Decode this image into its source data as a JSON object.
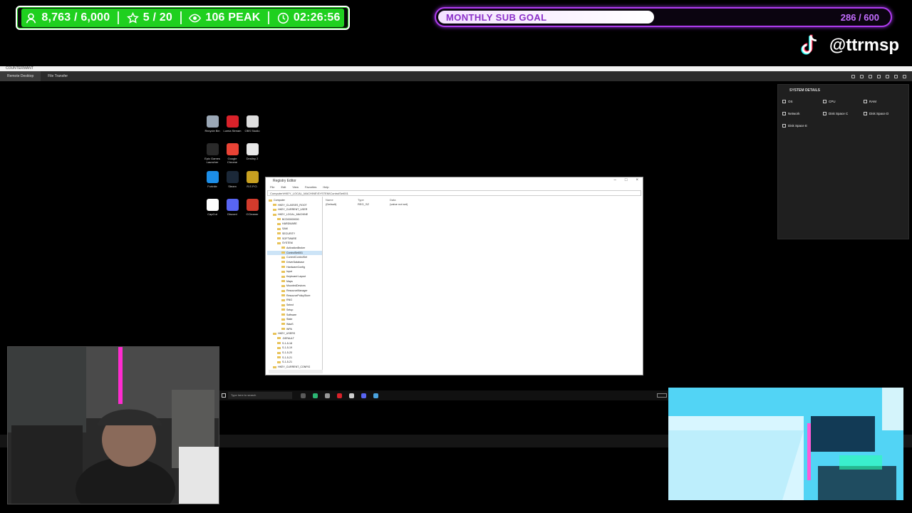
{
  "overlay": {
    "stats": {
      "followers": "8,763 / 6,000",
      "subs": "5 / 20",
      "peak": "106 PEAK",
      "timer": "02:26:56"
    },
    "goal": {
      "label": "MONTHLY SUB GOAL",
      "count": "286 / 600",
      "progress": 0.48
    },
    "tiktok_handle": "@ttrmsp"
  },
  "remote_desktop": {
    "title": "COUNTERMANT",
    "tabs": [
      "Remote Desktop",
      "File Transfer"
    ]
  },
  "desktop_icons": [
    {
      "label": "Recycle Bin",
      "icon": "recycle-bin-icon",
      "color": "#9aa7b5"
    },
    {
      "label": "Lumia Stream",
      "icon": "lumia-icon",
      "color": "#d9222a"
    },
    {
      "label": "OBS Studio",
      "icon": "obs-icon",
      "color": "#dddddd"
    },
    {
      "label": "Epic Games Launcher",
      "icon": "epic-icon",
      "color": "#2a2a2a"
    },
    {
      "label": "Google Chrome",
      "icon": "chrome-icon",
      "color": "#e94335"
    },
    {
      "label": "Destiny 2",
      "icon": "destiny-icon",
      "color": "#e8e8e8"
    },
    {
      "label": "Fortnite",
      "icon": "fortnite-icon",
      "color": "#1c8ee8"
    },
    {
      "label": "Steam",
      "icon": "steam-icon",
      "color": "#1b2838"
    },
    {
      "label": "R.E.P.O.",
      "icon": "repo-icon",
      "color": "#c8a020"
    },
    {
      "label": "CapCut",
      "icon": "capcut-icon",
      "color": "#ffffff"
    },
    {
      "label": "Discord",
      "icon": "discord-icon",
      "color": "#5865f2"
    },
    {
      "label": "CCleaner",
      "icon": "ccleaner-icon",
      "color": "#d23b2c"
    }
  ],
  "system_details": {
    "header": "SYSTEM DETAILS",
    "items": [
      {
        "label": "OS"
      },
      {
        "label": "CPU"
      },
      {
        "label": "RAM"
      },
      {
        "label": "Network"
      },
      {
        "label": "Disk Space C"
      },
      {
        "label": "Disk Space D"
      },
      {
        "label": "Disk Space E"
      }
    ]
  },
  "regedit": {
    "title": "Registry Editor",
    "menu": [
      "File",
      "Edit",
      "View",
      "Favorites",
      "Help"
    ],
    "address": "Computer\\HKEY_LOCAL_MACHINE\\SYSTEM\\ControlSet001",
    "tree": [
      "Computer",
      "HKEY_CLASSES_ROOT",
      "HKEY_CURRENT_USER",
      "HKEY_LOCAL_MACHINE",
      "BCD00000000",
      "HARDWARE",
      "SAM",
      "SECURITY",
      "SOFTWARE",
      "SYSTEM",
      "ActivationBroker",
      "ControlSet001",
      "CurrentControlSet",
      "DriverDatabase",
      "HardwareConfig",
      "Input",
      "Keyboard Layout",
      "Maps",
      "MountedDevices",
      "ResourceManager",
      "ResourcePolicyStore",
      "RNG",
      "Select",
      "Setup",
      "Software",
      "State",
      "WaaS",
      "WPA",
      "HKEY_USERS",
      ".DEFAULT",
      "S-1-5-18",
      "S-1-5-19",
      "S-1-5-20",
      "S-1-5-21",
      "S-1-5-21",
      "HKEY_CURRENT_CONFIG"
    ],
    "columns": [
      "Name",
      "Type",
      "Data"
    ],
    "rows": [
      {
        "name": "(Default)",
        "type": "REG_SZ",
        "data": "(value not set)"
      }
    ]
  },
  "taskbar": {
    "search_placeholder": "Type here to search"
  }
}
